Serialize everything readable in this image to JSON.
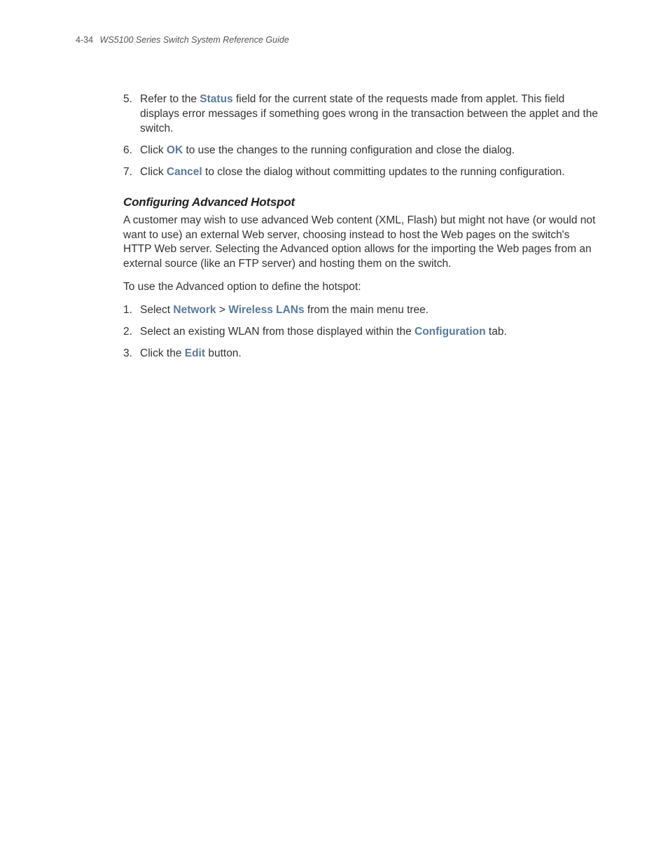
{
  "header": {
    "page_chapter": "4-34",
    "doc_title": "WS5100 Series Switch System Reference Guide"
  },
  "list1": {
    "items": [
      {
        "n": "5.",
        "pre1": "Refer to the ",
        "kw1": "Status",
        "post1": " field for the current state of the requests made from applet. This field displays error messages if something goes wrong in the transaction between the applet and the switch."
      },
      {
        "n": "6.",
        "pre1": "Click ",
        "kw1": "OK",
        "post1": " to use the changes to the running configuration and close the dialog."
      },
      {
        "n": "7.",
        "pre1": "Click ",
        "kw1": "Cancel",
        "post1": " to close the dialog without committing updates to the running configuration."
      }
    ]
  },
  "section": {
    "heading": "Configuring Advanced Hotspot",
    "para1": "A customer may wish to use advanced Web content (XML, Flash) but might not have (or would not want to use) an external Web server, choosing instead to host the Web pages on the switch's HTTP Web server. Selecting the Advanced option allows for the importing the Web pages from an external source (like an FTP server) and hosting them on the switch.",
    "para2": "To use the Advanced option to define the hotspot:"
  },
  "list2": {
    "items": [
      {
        "n": "1.",
        "pre1": "Select ",
        "kw1": "Network",
        "mid1": " > ",
        "kw2": "Wireless LANs",
        "post1": " from the main menu tree."
      },
      {
        "n": "2.",
        "pre1": "Select an existing WLAN from those displayed within the ",
        "kw1": "Configuration",
        "post1": " tab."
      },
      {
        "n": "3.",
        "pre1": "Click the ",
        "kw1": "Edit",
        "post1": " button."
      }
    ]
  }
}
